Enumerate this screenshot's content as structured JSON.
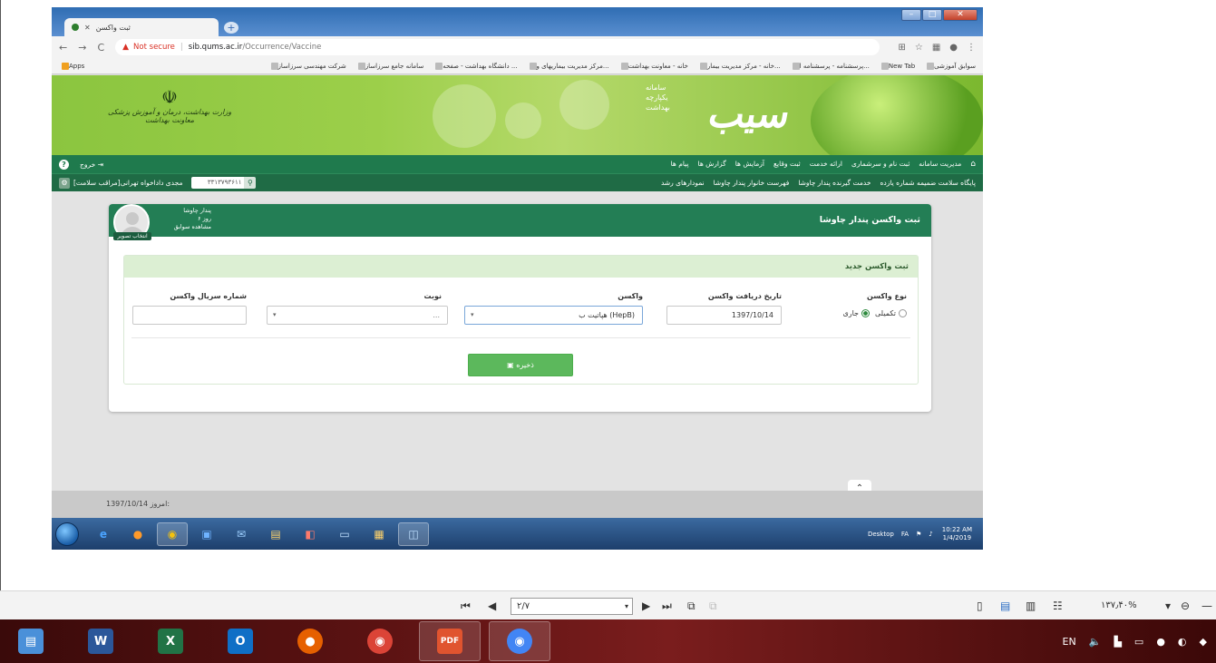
{
  "browser": {
    "tab_title": "ثبت واکسن",
    "new_tab_symbol": "+",
    "not_secure": "Not secure",
    "url_host": "sib.qums.ac.ir",
    "url_path": "/Occurrence/Vaccine",
    "bookmarks": [
      "سوابق آموزشی",
      "New Tab",
      "پرسشنامه - پرسشنامه ا...",
      "خانه - مرکز مدیریت بیمار...",
      "خانه - معاونت بهداشت",
      "مرکز مدیریت بیماریهای و...",
      "دانشگاه بهداشت - صفحه ...",
      "سامانه جامع سرزاساز",
      "شرکت مهندسی سرزاساز"
    ],
    "apps_label": "Apps"
  },
  "site": {
    "ministry_lines": [
      "وزارت بهداشت، درمان و آموزش پزشکی",
      "معاونت بهداشت"
    ],
    "sib_lines": [
      "سامانه",
      "یکپارچه",
      "بهداشت"
    ],
    "sib_logo": "سیب"
  },
  "main_nav": {
    "items": [
      "مدیریت سامانه",
      "ثبت نام و سرشماری",
      "ارائه خدمت",
      "ثبت وقایع",
      "آزمایش ها",
      "گزارش ها",
      "پیام ها"
    ],
    "exit_label": "خروج"
  },
  "sub_nav": {
    "items": [
      "پایگاه سلامت ضمیمه شماره یازده",
      "خدمت گیرنده پندار چاوشا",
      "فهرست خانوار پندار چاوشا",
      "نمودارهای رشد"
    ],
    "search_value": "۳۳۱۳۷۹۳۶۱۱",
    "user_label": "مجدی داداخواه تهرانی[مراقب سلامت]"
  },
  "card": {
    "title": "ثبت واکسن پندار چاوشا",
    "patient_name": "پندار چاوشا",
    "patient_age": "۶ روز",
    "view_history": "مشاهده سوابق",
    "choose_photo": "انتخاب تصویر"
  },
  "form": {
    "section_title": "ثبت واکسن جدید",
    "labels": {
      "vaccine_type": "نوع واکسن",
      "receive_date": "تاریخ دریافت واکسن",
      "vaccine": "واکسن",
      "dose": "نوبت",
      "serial": "شماره سریال واکسن"
    },
    "radio_current": "جاری",
    "radio_supplementary": "تکمیلی",
    "receive_date_value": "1397/10/14",
    "vaccine_value": "هپاتیت ب (HepB)",
    "dose_value": "...",
    "serial_value": "",
    "save_label": "ذخیره"
  },
  "footer": {
    "today_label": "امروز:",
    "today_value": "1397/10/14"
  },
  "inner_taskbar": {
    "desktop_label": "Desktop",
    "lang": "FA",
    "time": "10:22 AM",
    "date": "1/4/2019"
  },
  "viewer": {
    "page_value": "۲/۷",
    "zoom_value": "۱۳۷٫۴۰%"
  },
  "taskbar": {
    "lang": "EN"
  }
}
